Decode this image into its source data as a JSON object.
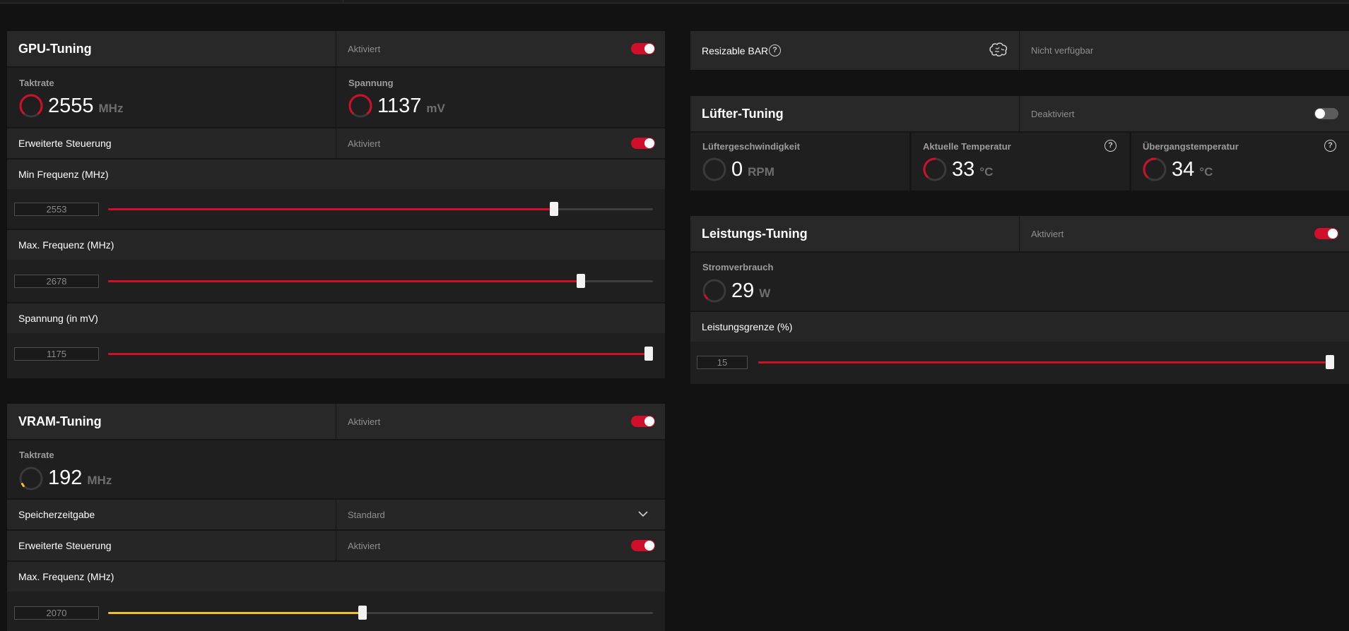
{
  "colors": {
    "accent": "#d0102a",
    "vram_accent": "#f0c02a",
    "panel": "#202020",
    "background": "#121212"
  },
  "gpu_tuning": {
    "title": "GPU-Tuning",
    "status": "Aktiviert",
    "toggle": true,
    "clock": {
      "label": "Taktrate",
      "value": "2555",
      "unit": "MHz"
    },
    "voltage": {
      "label": "Spannung",
      "value": "1137",
      "unit": "mV"
    },
    "advanced": {
      "label": "Erweiterte Steuerung",
      "status": "Aktiviert",
      "toggle": true
    },
    "sliders": [
      {
        "label": "Min Frequenz (MHz)",
        "value": "2553",
        "fill_fraction": 0.818
      },
      {
        "label": "Max. Frequenz (MHz)",
        "value": "2678",
        "fill_fraction": 0.868
      },
      {
        "label": "Spannung (in mV)",
        "value": "1175",
        "fill_fraction": 1.0
      }
    ]
  },
  "vram_tuning": {
    "title": "VRAM-Tuning",
    "status": "Aktiviert",
    "toggle": true,
    "clock": {
      "label": "Taktrate",
      "value": "192",
      "unit": "MHz"
    },
    "memory_timing": {
      "label": "Speicherzeitgabe",
      "value": "Standard"
    },
    "advanced": {
      "label": "Erweiterte Steuerung",
      "status": "Aktiviert",
      "toggle": true
    },
    "slider": {
      "label": "Max. Frequenz (MHz)",
      "value": "2070",
      "fill_fraction": 0.467
    }
  },
  "resizable_bar": {
    "label": "Resizable BAR",
    "help": "?",
    "icon": "brain-icon",
    "value": "Nicht verfügbar"
  },
  "fan_tuning": {
    "title": "Lüfter-Tuning",
    "status": "Deaktiviert",
    "toggle": false,
    "fan_speed": {
      "label": "Lüftergeschwindigkeit",
      "value": "0",
      "unit": "RPM"
    },
    "current_temp": {
      "label": "Aktuelle Temperatur",
      "value": "33",
      "unit": "°C",
      "help": "?"
    },
    "junction_temp": {
      "label": "Übergangstemperatur",
      "value": "34",
      "unit": "°C",
      "help": "?"
    }
  },
  "power_tuning": {
    "title": "Leistungs-Tuning",
    "status": "Aktiviert",
    "toggle": true,
    "power": {
      "label": "Stromverbrauch",
      "value": "29",
      "unit": "W"
    },
    "limit": {
      "label": "Leistungsgrenze (%)",
      "value": "15",
      "fill_fraction": 1.0
    }
  }
}
